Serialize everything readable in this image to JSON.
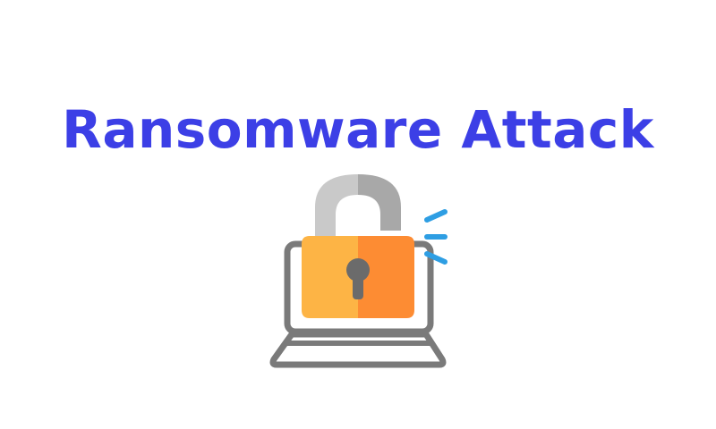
{
  "title": "Ransomware Attack",
  "colors": {
    "title": "#3c3fe6",
    "shackle_left": "#c9c9c9",
    "shackle_right": "#a8a8a8",
    "lock_left": "#fdb445",
    "lock_right": "#fd8c33",
    "keyhole": "#6b6b6b",
    "laptop_outline": "#7a7a7a",
    "alert_lines": "#2e9ee3"
  },
  "icons": {
    "illustration": "laptop-with-open-padlock",
    "alert": "alert-lines-icon"
  }
}
